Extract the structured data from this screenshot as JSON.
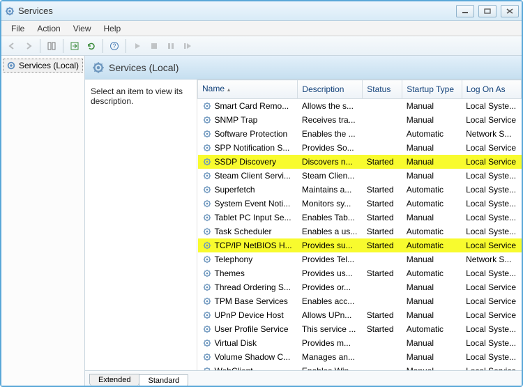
{
  "window": {
    "title": "Services"
  },
  "menu": {
    "file": "File",
    "action": "Action",
    "view": "View",
    "help": "Help"
  },
  "tree": {
    "root": "Services (Local)"
  },
  "header": {
    "title": "Services (Local)"
  },
  "desc": {
    "line1": "Select an item to view its",
    "line2": "description."
  },
  "columns": {
    "name": "Name",
    "desc": "Description",
    "status": "Status",
    "startup": "Startup Type",
    "logon": "Log On As"
  },
  "tabs": {
    "extended": "Extended",
    "standard": "Standard"
  },
  "services": [
    {
      "name": "Smart Card Remo...",
      "desc": "Allows the s...",
      "status": "",
      "startup": "Manual",
      "logon": "Local Syste...",
      "hl": false
    },
    {
      "name": "SNMP Trap",
      "desc": "Receives tra...",
      "status": "",
      "startup": "Manual",
      "logon": "Local Service",
      "hl": false
    },
    {
      "name": "Software Protection",
      "desc": "Enables the ...",
      "status": "",
      "startup": "Automatic",
      "logon": "Network S...",
      "hl": false
    },
    {
      "name": "SPP Notification S...",
      "desc": "Provides So...",
      "status": "",
      "startup": "Manual",
      "logon": "Local Service",
      "hl": false
    },
    {
      "name": "SSDP Discovery",
      "desc": "Discovers n...",
      "status": "Started",
      "startup": "Manual",
      "logon": "Local Service",
      "hl": true
    },
    {
      "name": "Steam Client Servi...",
      "desc": "Steam Clien...",
      "status": "",
      "startup": "Manual",
      "logon": "Local Syste...",
      "hl": false
    },
    {
      "name": "Superfetch",
      "desc": "Maintains a...",
      "status": "Started",
      "startup": "Automatic",
      "logon": "Local Syste...",
      "hl": false
    },
    {
      "name": "System Event Noti...",
      "desc": "Monitors sy...",
      "status": "Started",
      "startup": "Automatic",
      "logon": "Local Syste...",
      "hl": false
    },
    {
      "name": "Tablet PC Input Se...",
      "desc": "Enables Tab...",
      "status": "Started",
      "startup": "Manual",
      "logon": "Local Syste...",
      "hl": false
    },
    {
      "name": "Task Scheduler",
      "desc": "Enables a us...",
      "status": "Started",
      "startup": "Automatic",
      "logon": "Local Syste...",
      "hl": false
    },
    {
      "name": "TCP/IP NetBIOS H...",
      "desc": "Provides su...",
      "status": "Started",
      "startup": "Automatic",
      "logon": "Local Service",
      "hl": true
    },
    {
      "name": "Telephony",
      "desc": "Provides Tel...",
      "status": "",
      "startup": "Manual",
      "logon": "Network S...",
      "hl": false
    },
    {
      "name": "Themes",
      "desc": "Provides us...",
      "status": "Started",
      "startup": "Automatic",
      "logon": "Local Syste...",
      "hl": false
    },
    {
      "name": "Thread Ordering S...",
      "desc": "Provides or...",
      "status": "",
      "startup": "Manual",
      "logon": "Local Service",
      "hl": false
    },
    {
      "name": "TPM Base Services",
      "desc": "Enables acc...",
      "status": "",
      "startup": "Manual",
      "logon": "Local Service",
      "hl": false
    },
    {
      "name": "UPnP Device Host",
      "desc": "Allows UPn...",
      "status": "Started",
      "startup": "Manual",
      "logon": "Local Service",
      "hl": false
    },
    {
      "name": "User Profile Service",
      "desc": "This service ...",
      "status": "Started",
      "startup": "Automatic",
      "logon": "Local Syste...",
      "hl": false
    },
    {
      "name": "Virtual Disk",
      "desc": "Provides m...",
      "status": "",
      "startup": "Manual",
      "logon": "Local Syste...",
      "hl": false
    },
    {
      "name": "Volume Shadow C...",
      "desc": "Manages an...",
      "status": "",
      "startup": "Manual",
      "logon": "Local Syste...",
      "hl": false
    },
    {
      "name": "WebClient",
      "desc": "Enables Win...",
      "status": "",
      "startup": "Manual",
      "logon": "Local Service",
      "hl": false
    }
  ]
}
